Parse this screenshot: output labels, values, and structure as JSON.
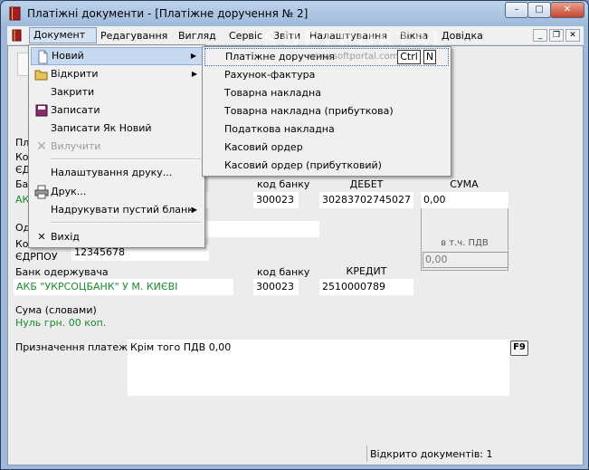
{
  "window": {
    "title": "Платіжні документи - [Платіжне доручення № 2]",
    "controls": {
      "minimize": "–",
      "maximize": "□",
      "close": "✕"
    }
  },
  "menubar": {
    "items": [
      "Документ",
      "Редагування",
      "Вигляд",
      "Сервіс",
      "Звіти",
      "Налаштування",
      "Вікна",
      "Довідка"
    ],
    "mdi_controls": {
      "minimize": "_",
      "restore": "❐",
      "close": "✕"
    }
  },
  "document_menu": {
    "items": [
      {
        "label": "Новий",
        "icon": "new-document-icon",
        "has_submenu": true,
        "highlighted": true
      },
      {
        "label": "Відкрити",
        "icon": "open-folder-icon",
        "has_submenu": true
      },
      {
        "label": "Закрити"
      },
      {
        "label": "Записати",
        "icon": "save-disk-icon"
      },
      {
        "label": "Записати Як Новий"
      },
      {
        "label": "Вилучити",
        "icon": "delete-icon",
        "disabled": true
      },
      {
        "label": "Налаштування друку..."
      },
      {
        "label": "Друк...",
        "icon": "printer-icon"
      },
      {
        "label": "Надрукувати пустий бланк",
        "has_submenu": true
      },
      {
        "label": "Вихід",
        "icon": "exit-icon"
      }
    ]
  },
  "new_submenu": {
    "items": [
      {
        "label": "Платіжне доручення",
        "shortcut": [
          "Ctrl",
          "N"
        ],
        "highlighted": true
      },
      {
        "label": "Рахунок-фактура"
      },
      {
        "label": "Товарна накладна"
      },
      {
        "label": "Товарна накладна (прибуткова)"
      },
      {
        "label": "Податкова накладна"
      },
      {
        "label": "Касовий ордер"
      },
      {
        "label": "Касовий ордер (прибутковий)"
      }
    ]
  },
  "watermark": {
    "text": "SOFTPORTAL",
    "url": "www.softportal.com"
  },
  "form": {
    "partial_labels": {
      "pl": "Пл",
      "ko1": "Ко",
      "edr1": "ЄД",
      "ba": "Ба",
      "od": "Од",
      "ko2": "Ко"
    },
    "payer": {
      "bank_name": "АК",
      "bank_code_header": "код банку",
      "bank_code": "300023",
      "debit_header": "ДЕБЕТ",
      "debit_account": "30283702745027",
      "sum_header": "СУМА",
      "sum": "0,00"
    },
    "vat": {
      "label": "в т.ч. ПДВ",
      "value": "0,00"
    },
    "receiver": {
      "edrpou_label": "ЄДРПОУ",
      "edrpou": "12345678",
      "bank_label": "Банк одержувача",
      "bank_name": "АКБ \"УКРСОЦБАНК\" У М. КИЄВІ",
      "bank_code_header": "код банку",
      "bank_code": "300023",
      "credit_header": "КРЕДИТ",
      "credit_account": "2510000789"
    },
    "sum_words_label": "Сума (словами)",
    "sum_words": "Нуль грн. 00 коп.",
    "purpose_label": "Призначення платежу:",
    "purpose": "Крім того ПДВ 0,00",
    "f9_button": "F9"
  },
  "status_bar": {
    "text": "Відкрито документів: 1"
  }
}
